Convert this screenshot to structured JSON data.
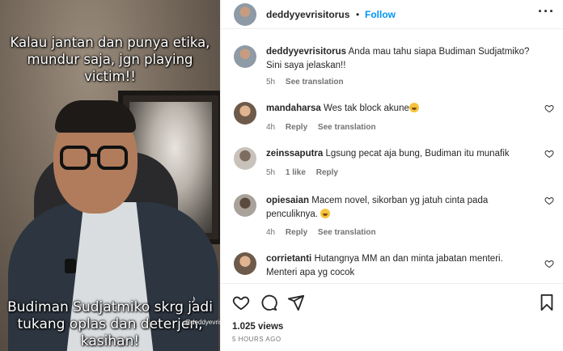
{
  "media": {
    "caption_top": "Kalau jantan dan punya etika, mundur saja, jgn playing victim!!",
    "caption_bottom": "Budiman Sudjatmiko skrg jadi tukang oplas dan deterjen, kasihan!",
    "watermark_logo": "TikTok",
    "watermark_handle": "@deddyevrisitorus"
  },
  "header": {
    "username": "deddyyevrisitorus",
    "separator": "•",
    "follow_label": "Follow",
    "more_icon": "more-horizontal-icon"
  },
  "comments": [
    {
      "username": "deddyyevrisitorus",
      "text": "Anda mau tahu siapa Budiman Sudjatmiko? Sini saya jelaskan!!",
      "time": "5h",
      "likes": "",
      "actions": [
        "See translation"
      ],
      "has_heart": false
    },
    {
      "username": "mandaharsa",
      "text": "Wes tak block akune",
      "emoji": "grinning-sweat-emoji",
      "time": "4h",
      "likes": "",
      "actions": [
        "Reply",
        "See translation"
      ],
      "has_heart": true
    },
    {
      "username": "zeinssaputra",
      "text": "Lgsung pecat aja bung, Budiman itu munafik",
      "time": "5h",
      "likes": "1 like",
      "actions": [
        "Reply"
      ],
      "has_heart": true
    },
    {
      "username": "opiesaian",
      "text": "Macem novel, sikorban yg jatuh cinta pada penculiknya.",
      "emoji": "grinning-emoji",
      "time": "4h",
      "likes": "",
      "actions": [
        "Reply",
        "See translation"
      ],
      "has_heart": true
    },
    {
      "username": "corrietanti",
      "text": "Hutangnya MM an dan minta jabatan menteri. Menteri apa yg cocok",
      "time": "",
      "likes": "",
      "actions": [],
      "has_heart": true
    }
  ],
  "actions": {
    "icons": [
      "heart-icon",
      "comment-icon",
      "share-icon",
      "bookmark-icon"
    ],
    "views": "1.025 views",
    "timestamp": "5 HOURS AGO"
  },
  "colors": {
    "link_blue": "#0095f6",
    "text": "#262626",
    "secondary": "#737373"
  }
}
